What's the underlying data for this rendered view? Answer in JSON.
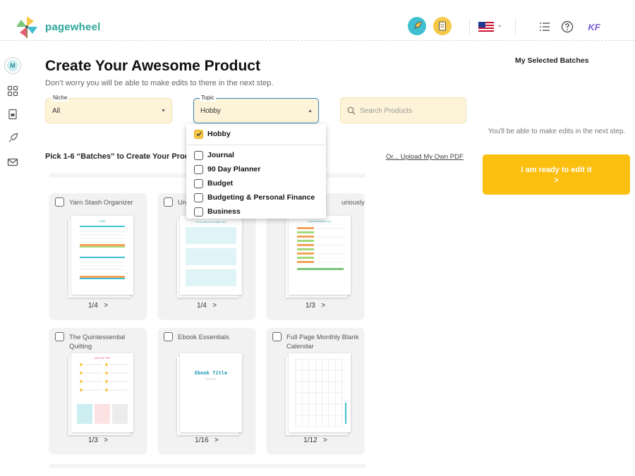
{
  "header": {
    "brand": "pagewheel",
    "icons": [
      "pinwheel-logo",
      "rocket-icon",
      "document-icon",
      "us-flag-icon",
      "chevron-down-icon",
      "list-icon",
      "help-icon",
      "user-initials-icon"
    ],
    "user_initials": "KF"
  },
  "sidebar": {
    "avatar": "M",
    "items": [
      "grid-icon",
      "document-icon",
      "rocket-icon",
      "mail-icon"
    ]
  },
  "main": {
    "title": "Create Your Awesome Product",
    "subtitle": "Don’t worry you will be able to make edits to there in the next step.",
    "niche": {
      "label": "Niche",
      "value": "All"
    },
    "topic": {
      "label": "Topic",
      "value": "Hobby"
    },
    "search": {
      "placeholder": "Search Products"
    },
    "pick_text": "Pick 1-6 “Batches” to Create Your Prod",
    "upload_link": "Or... Upload My Own PDF",
    "topic_options": [
      {
        "label": "Hobby",
        "checked": true
      },
      {
        "label": "Journal",
        "checked": false
      },
      {
        "label": "90 Day Planner",
        "checked": false
      },
      {
        "label": "Budget",
        "checked": false
      },
      {
        "label": "Budgeting & Personal Finance",
        "checked": false
      },
      {
        "label": "Business",
        "checked": false
      }
    ],
    "cards": [
      {
        "title": "Yarn Stash Organizer",
        "page": "1",
        "total": "/4",
        "next": ">"
      },
      {
        "title": "Un",
        "page": "1",
        "total": "/4",
        "next": ">"
      },
      {
        "title": "uriously",
        "page": "1",
        "total": "/3",
        "next": ">"
      },
      {
        "title": "The Quintessential Quilting",
        "page": "1",
        "total": "/3",
        "next": ">"
      },
      {
        "title": "Ebook Essentials",
        "page": "1",
        "total": "/16",
        "next": ">",
        "cover_title": "Ebook Title"
      },
      {
        "title": "Full Page Monthly Blank Calendar",
        "page": "1",
        "total": "/12",
        "next": ">"
      }
    ]
  },
  "right_panel": {
    "title": "My Selected Batches",
    "note": "You'll be able to make edits in the next step.",
    "button_line1": "I am ready to edit it",
    "button_line2": ">"
  },
  "colors": {
    "brand": "#2fa79a",
    "accent_yellow": "#fbbf10",
    "field_bg": "#fdf3d8",
    "focus_border": "#2f7fb8"
  }
}
